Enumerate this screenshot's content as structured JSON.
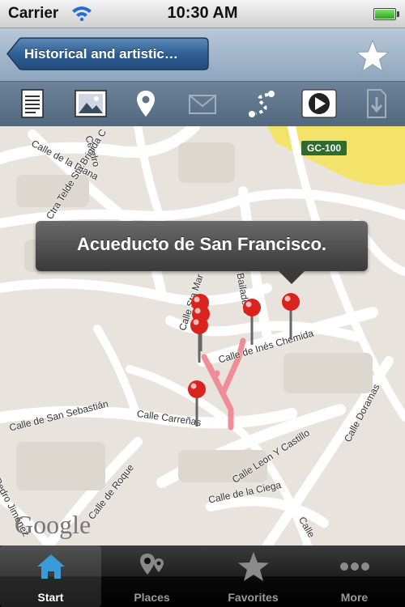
{
  "status_bar": {
    "carrier": "Carrier",
    "time": "10:30 AM",
    "battery_level": 1.0
  },
  "nav": {
    "back_label": "Historical and artistic…",
    "favorite_icon": "star-icon"
  },
  "toolbar": {
    "icons": [
      "document-icon",
      "image-icon",
      "location-pin-icon",
      "mail-icon",
      "route-icon",
      "play-icon",
      "download-icon"
    ]
  },
  "map": {
    "callout": "Acueducto de San Francisco.",
    "road_shield": "GC-100",
    "attribution": "Google",
    "streets": {
      "calle_de_la_diana": "Calle de la Diana",
      "cendro": "Cendro",
      "ctra_telde": "Ctra Telde Sta Brigida C",
      "sta_maria": "Calle Sta Mar",
      "bailadero": "Calle Bailadero",
      "ines_chemida": "Calle de Inés Chemida",
      "san_sebastian": "Calle de San Sebastián",
      "carrenas": "Calle Carreñas",
      "de_roque": "Calle de Roque",
      "leon_y_castillo": "Calle Leon Y Castillo",
      "doramas": "Calle Doramas",
      "de_la_ciega": "Calle de la Ciega",
      "pedro_jimenez": "Pedro Jiménez",
      "calle_short": "Calle"
    }
  },
  "tabs": [
    {
      "label": "Start",
      "icon": "home-icon",
      "active": true
    },
    {
      "label": "Places",
      "icon": "places-icon",
      "active": false
    },
    {
      "label": "Favorites",
      "icon": "star-icon",
      "active": false
    },
    {
      "label": "More",
      "icon": "more-icon",
      "active": false
    }
  ],
  "colors": {
    "accent": "#3b9bd8",
    "pin": "#d9231e",
    "route": "#f0838e"
  }
}
